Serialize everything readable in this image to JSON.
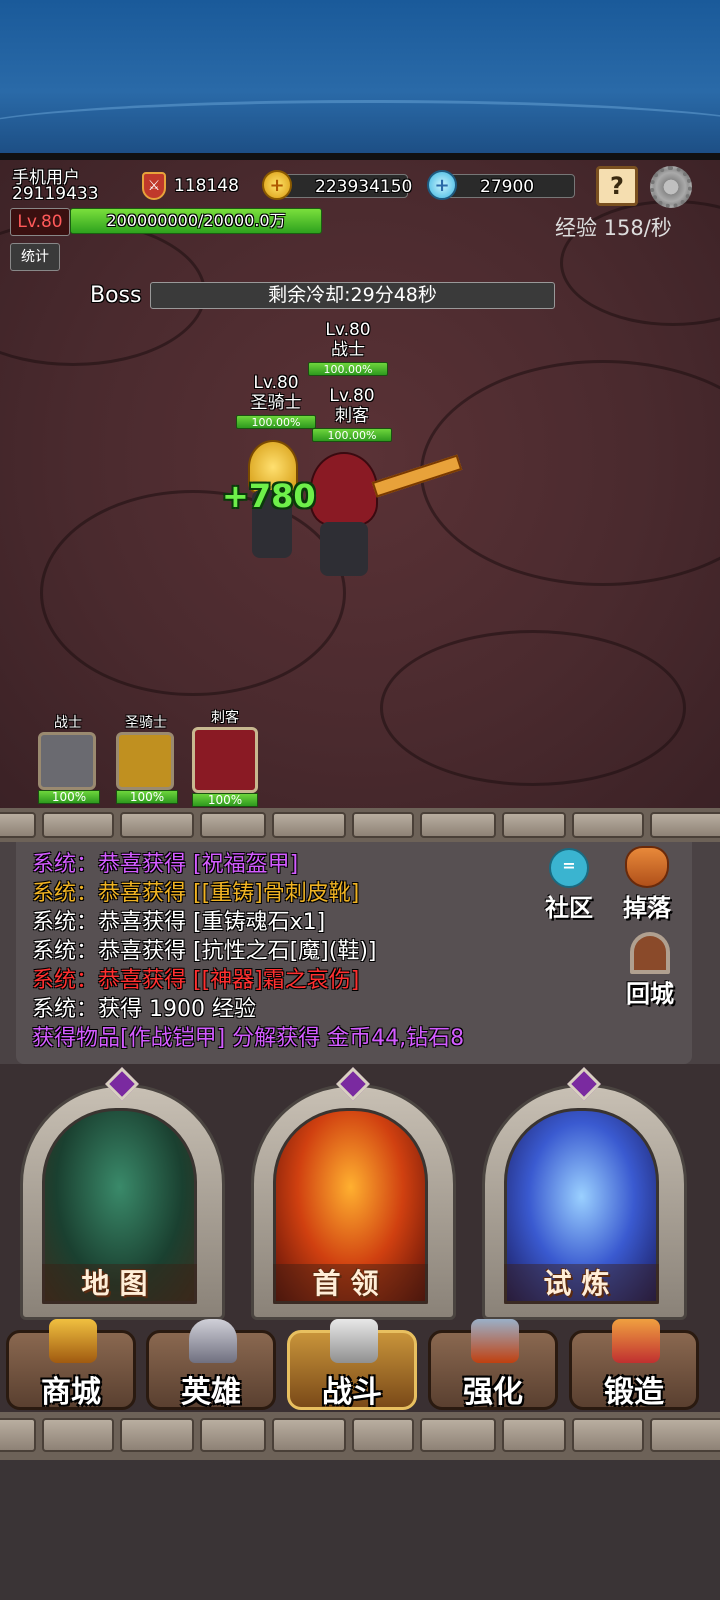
{
  "player": {
    "name": "手机用户",
    "id": "29119433",
    "level": "Lv.80",
    "exp_bar": "200000000/20000.0万",
    "exp_rate": "经验 158/秒",
    "stats_label": "统计"
  },
  "resources": {
    "power": "118148",
    "gold": "223934150",
    "gold_icon_glyph": "+",
    "gems": "27900",
    "gem_icon_glyph": "+"
  },
  "icons": {
    "power": "shield-sword-icon",
    "quest": "quest-book-icon",
    "quest_glyph": "?",
    "settings": "gear-icon"
  },
  "boss": {
    "label": "Boss",
    "cooldown": "剩余冷却:29分48秒"
  },
  "battle_heroes": [
    {
      "level": "Lv.80",
      "name": "战士",
      "hp": "100.00%"
    },
    {
      "level": "Lv.80",
      "name": "圣骑士",
      "hp": "100.00%"
    },
    {
      "level": "Lv.80",
      "name": "刺客",
      "hp": "100.00%"
    }
  ],
  "heal_popup": "+780",
  "party": [
    {
      "name": "战士",
      "hp": "100%"
    },
    {
      "name": "圣骑士",
      "hp": "100%"
    },
    {
      "name": "刺客",
      "hp": "100%"
    }
  ],
  "log": [
    {
      "text": "系统：恭喜获得 [祝福盔甲]",
      "color": "#d35cff"
    },
    {
      "text": "系统：恭喜获得 [[重铸]骨刺皮靴]",
      "color": "#f0b323"
    },
    {
      "text": "系统：恭喜获得 [重铸魂石x1]",
      "color": "#ffffff"
    },
    {
      "text": "系统：恭喜获得 [抗性之石[魔](鞋)]",
      "color": "#ffffff"
    },
    {
      "text": "系统：恭喜获得 [[神器]霜之哀伤]",
      "color": "#ff3030"
    },
    {
      "text": "系统：获得 1900 经验",
      "color": "#ffffff"
    },
    {
      "text": "获得物品[作战铠甲] 分解获得 金币44,钻石8",
      "color": "#d35cff"
    }
  ],
  "side_buttons": {
    "community": "社区",
    "community_glyph": "=",
    "drop": "掉落",
    "town": "回城"
  },
  "cards": [
    {
      "label": "地图"
    },
    {
      "label": "首领"
    },
    {
      "label": "试炼"
    }
  ],
  "nav": [
    {
      "label": "商城",
      "active": false
    },
    {
      "label": "英雄",
      "active": false
    },
    {
      "label": "战斗",
      "active": true
    },
    {
      "label": "强化",
      "active": false
    },
    {
      "label": "锻造",
      "active": false
    }
  ]
}
